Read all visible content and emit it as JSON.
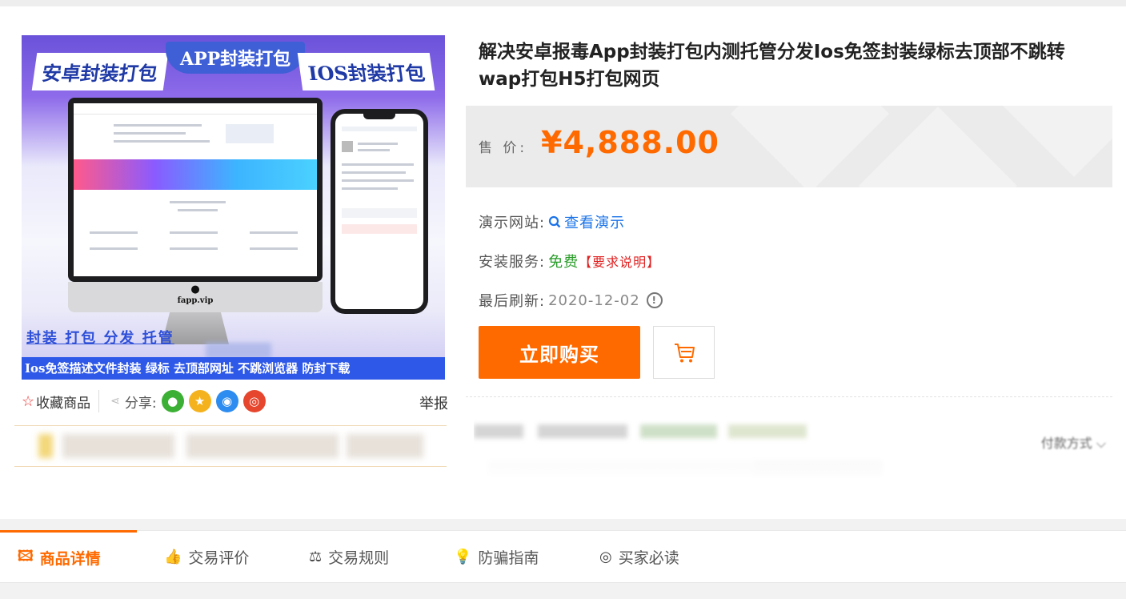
{
  "product": {
    "title": "解决安卓报毒App封装打包内测托管分发Ios免签封装绿标去顶部不跳转wap打包H5打包网页",
    "image_text": {
      "left_label": "安卓封装打包",
      "center_label": "APP封装打包",
      "right_label": "IOS封装打包",
      "brand": "fapp.vip",
      "tags": "封装 打包 分发 托管",
      "footer": "Ios免签描述文件封装  绿标  去顶部网址  不跳浏览器  防封下载"
    }
  },
  "price": {
    "label": "售 价:",
    "value": "¥4,888.00"
  },
  "demo_site": {
    "label": "演示网站:",
    "link": "查看演示"
  },
  "install_service": {
    "label": "安装服务:",
    "value": "免费",
    "note": "【要求说明】"
  },
  "last_refresh": {
    "label": "最后刷新:",
    "value": "2020-12-02"
  },
  "actions": {
    "buy": "立即购买"
  },
  "share": {
    "favorite": "收藏商品",
    "share_label": "分享:",
    "report": "举报"
  },
  "more": {
    "label": "付款方式"
  },
  "tabs": [
    {
      "label": "商品详情",
      "icon": "picture-icon"
    },
    {
      "label": "交易评价",
      "icon": "thumbs-up-icon"
    },
    {
      "label": "交易规则",
      "icon": "scale-icon"
    },
    {
      "label": "防骗指南",
      "icon": "lightbulb-icon"
    },
    {
      "label": "买家必读",
      "icon": "target-icon"
    }
  ],
  "colors": {
    "accent": "#ff6a00",
    "link": "#1a73e8",
    "free": "#2a9d2a",
    "red": "#e02020"
  }
}
